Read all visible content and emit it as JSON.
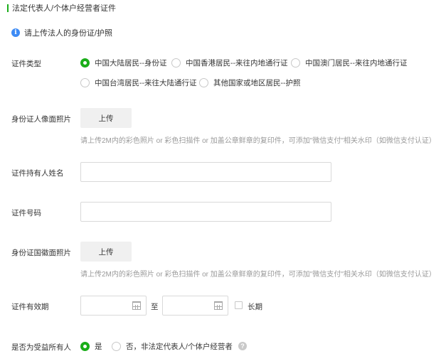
{
  "section": {
    "title": "法定代表人/个体户经营者证件"
  },
  "notice": {
    "icon": "info-icon",
    "text": "请上传法人的身份证/护照"
  },
  "id_type": {
    "label": "证件类型",
    "options": [
      {
        "label": "中国大陆居民--身份证",
        "checked": true
      },
      {
        "label": "中国香港居民--来往内地通行证",
        "checked": false
      },
      {
        "label": "中国澳门居民--来往内地通行证",
        "checked": false
      },
      {
        "label": "中国台湾居民--来往大陆通行证",
        "checked": false
      },
      {
        "label": "其他国家或地区居民--护照",
        "checked": false
      }
    ]
  },
  "front_photo": {
    "label": "身份证人像面照片",
    "button": "上传",
    "hint": "请上传2M内的彩色照片 or 彩色扫描件 or 加盖公章鲜章的复印件，可添加\"微信支付\"相关水印（如微信支付认证）"
  },
  "holder_name": {
    "label": "证件持有人姓名",
    "value": ""
  },
  "id_number": {
    "label": "证件号码",
    "value": ""
  },
  "back_photo": {
    "label": "身份证国徽面照片",
    "button": "上传",
    "hint": "请上传2M内的彩色照片 or 彩色扫描件 or 加盖公章鲜章的复印件，可添加\"微信支付\"相关水印（如微信支付认证）"
  },
  "validity": {
    "label": "证件有效期",
    "start_value": "",
    "end_value": "",
    "to_text": "至",
    "long_term_label": "长期",
    "long_term_checked": false,
    "icon": "calendar-icon"
  },
  "beneficiary": {
    "label": "是否为受益所有人",
    "options": [
      {
        "label": "是",
        "checked": true
      },
      {
        "label": "否，非法定代表人/个体户经营者",
        "checked": false
      }
    ],
    "help_icon": "question-icon",
    "help_glyph": "?"
  },
  "colors": {
    "accent": "#1aad19",
    "info": "#3d8bf5",
    "hint": "#9a9a9a"
  }
}
